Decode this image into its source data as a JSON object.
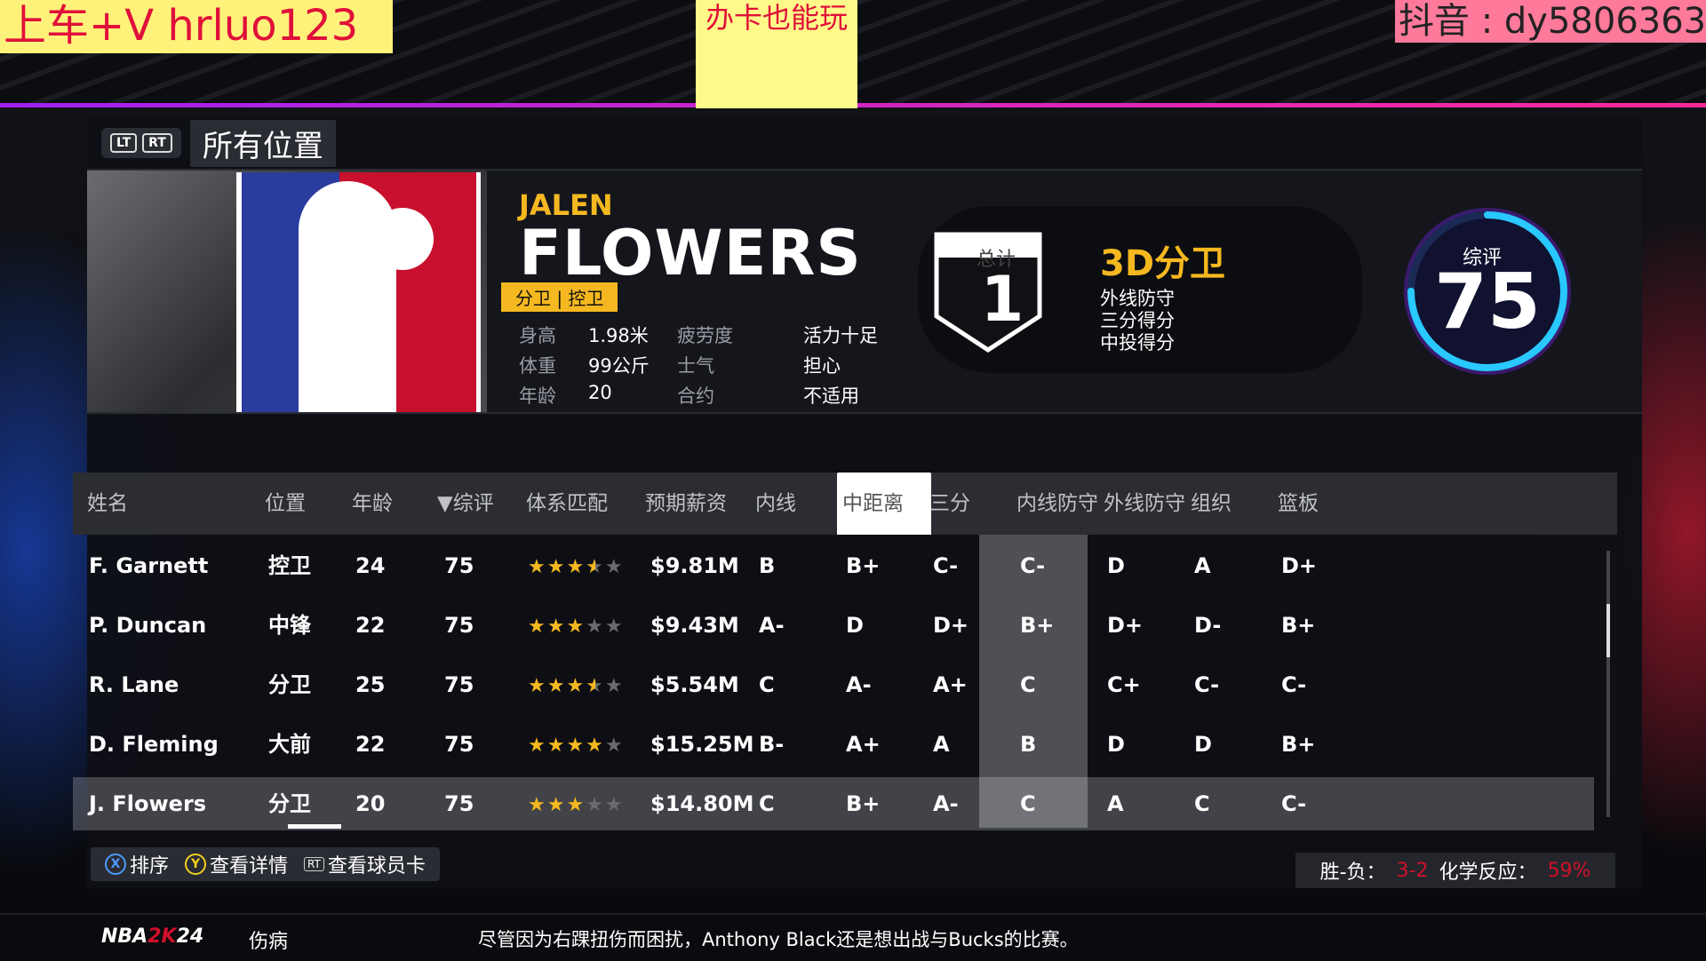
{
  "watermarks": {
    "left": "上车+V   hrluo123",
    "center": "办卡也能玩",
    "right": "抖音 : dy5806363"
  },
  "filter": {
    "lt": "LT",
    "rt": "RT",
    "title": "所有位置"
  },
  "player": {
    "first_name": "JALEN",
    "last_name": "FLOWERS",
    "positions": "分卫 | 控卫",
    "stats": [
      {
        "k": "身高",
        "v": "1.98米",
        "k2": "疲劳度",
        "v2": "活力十足"
      },
      {
        "k": "体重",
        "v": "99公斤",
        "k2": "士气",
        "v2": "担心"
      },
      {
        "k": "年龄",
        "v": "20",
        "k2": "合约",
        "v2": "不适用"
      }
    ],
    "rank_label": "总计",
    "rank": "1",
    "archetype": "3D分卫",
    "traits": [
      "外线防守",
      "三分得分",
      "中投得分"
    ],
    "overall_label": "综评",
    "overall": "75",
    "overall_fraction": 0.75
  },
  "table": {
    "headers": [
      "姓名",
      "位置",
      "年龄",
      "▼综评",
      "体系匹配",
      "预期薪资",
      "内线",
      "中距离",
      "三分",
      "内线防守",
      "外线防守",
      "组织",
      "篮板"
    ],
    "selected_column": 7,
    "rows": [
      {
        "name": "F. Garnett",
        "pos": "控卫",
        "age": "24",
        "ovr": "75",
        "stars": 3.5,
        "salary": "$9.81M",
        "ins": "B",
        "mid": "B+",
        "three": "C-",
        "idef": "C-",
        "pdef": "D",
        "play": "A",
        "reb": "D+"
      },
      {
        "name": "P. Duncan",
        "pos": "中锋",
        "age": "22",
        "ovr": "75",
        "stars": 3,
        "salary": "$9.43M",
        "ins": "A-",
        "mid": "D",
        "three": "D+",
        "idef": "B+",
        "pdef": "D+",
        "play": "D-",
        "reb": "B+"
      },
      {
        "name": "R. Lane",
        "pos": "分卫",
        "age": "25",
        "ovr": "75",
        "stars": 3.5,
        "salary": "$5.54M",
        "ins": "C",
        "mid": "A-",
        "three": "A+",
        "idef": "C",
        "pdef": "C+",
        "play": "C-",
        "reb": "C-"
      },
      {
        "name": "D. Fleming",
        "pos": "大前",
        "age": "22",
        "ovr": "75",
        "stars": 4,
        "salary": "$15.25M",
        "ins": "B-",
        "mid": "A+",
        "three": "A",
        "idef": "B",
        "pdef": "D",
        "play": "D",
        "reb": "B+"
      },
      {
        "name": "J. Flowers",
        "pos": "分卫",
        "age": "20",
        "ovr": "75",
        "stars": 3,
        "salary": "$14.80M",
        "ins": "C",
        "mid": "B+",
        "three": "A-",
        "idef": "C",
        "pdef": "A",
        "play": "C",
        "reb": "C-"
      }
    ],
    "selected_row": 4
  },
  "hints": [
    {
      "btn": "X",
      "label": "排序"
    },
    {
      "btn": "Y",
      "label": "查看详情"
    },
    {
      "btn": "RT",
      "label": "查看球员卡"
    }
  ],
  "record": {
    "wl_label": "胜-负：",
    "wl": "3-2",
    "chem_label": "化学反应：",
    "chem": "59%"
  },
  "ticker": {
    "logo_a": "NBA",
    "logo_b": "2K",
    "logo_c": "24",
    "category": "伤病",
    "message": "尽管因为右踝扭伤而困扰，Anthony Black还是想出战与Bucks的比赛。"
  }
}
